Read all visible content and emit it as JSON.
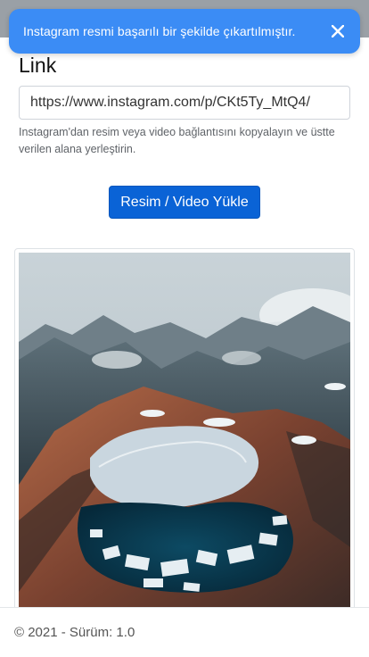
{
  "toast": {
    "message": "Instagram resmi başarılı bir şekilde çıkartılmıştır.",
    "close_icon": "close-icon",
    "bg_color": "#3b8cf5"
  },
  "form": {
    "label": "Link",
    "link_value": "https://www.instagram.com/p/CKt5Ty_MtQ4/",
    "help_text": "Instagram'dan resim veya video bağlantısını kopyalayın ve üstte verilen alana yerleştirin.",
    "upload_button": "Resim / Video Yükle",
    "button_color": "#0a63d6"
  },
  "media": {
    "image_subject": "aerial mountain lake with ice floes"
  },
  "footer": {
    "text": "© 2021 - Sürüm: 1.0"
  }
}
